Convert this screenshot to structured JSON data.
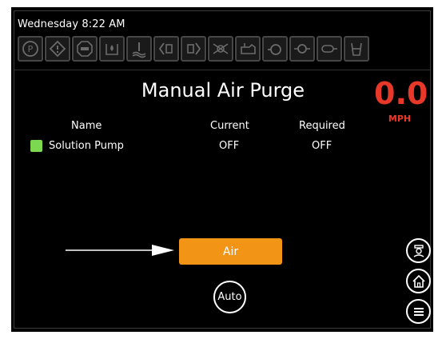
{
  "status_bar": {
    "datetime": "Wednesday 8:22 AM",
    "icons": [
      "parking-brake-icon",
      "warning-icon",
      "stop-icon",
      "fluid-level-icon",
      "water-temperature-icon",
      "left-turn-signal-icon",
      "right-turn-signal-icon",
      "light-icon",
      "engine-oil-icon",
      "engine-icon",
      "brush-motor-icon",
      "hydraulic-filter-icon",
      "recovery-tank-icon"
    ]
  },
  "screen": {
    "title": "Manual Air Purge",
    "speed_value": "0.0",
    "speed_unit": "MPH",
    "table": {
      "headers": {
        "name": "Name",
        "current": "Current",
        "required": "Required"
      },
      "rows": [
        {
          "name": "Solution Pump",
          "current": "OFF",
          "required": "OFF",
          "status_color": "#7cd84e"
        }
      ]
    },
    "air_button_label": "Air",
    "auto_button_label": "Auto"
  },
  "colors": {
    "background": "#000000",
    "accent_orange": "#f29416",
    "speed_red": "#e8382a",
    "active_green": "#7cd84e"
  }
}
